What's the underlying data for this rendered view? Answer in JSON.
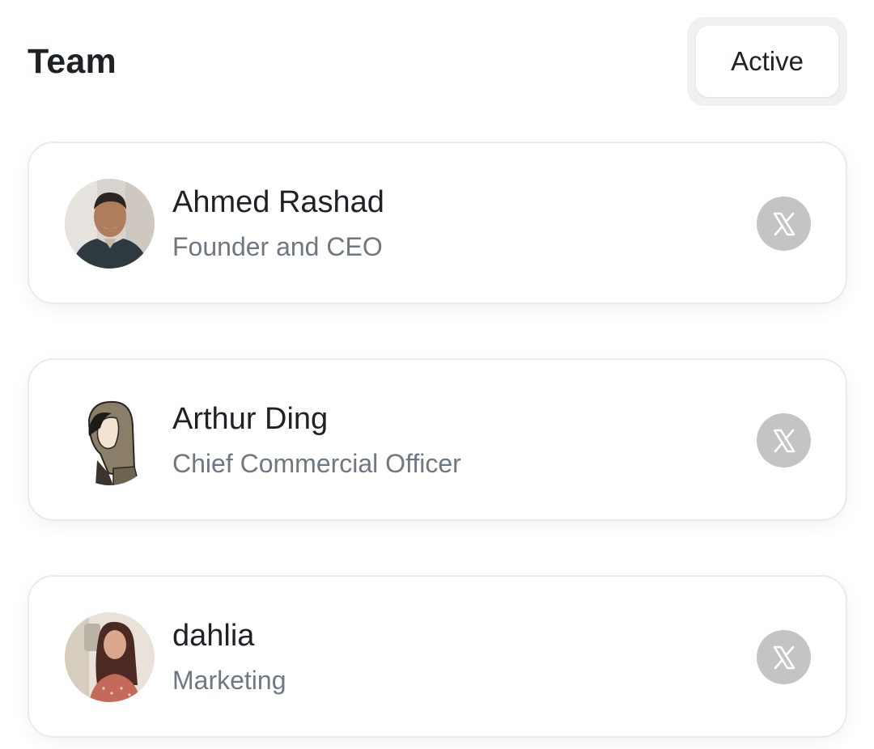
{
  "header": {
    "title": "Team",
    "filter_label": "Active"
  },
  "members": [
    {
      "name": "Ahmed Rashad",
      "role": "Founder and CEO",
      "social": "x-icon"
    },
    {
      "name": "Arthur Ding",
      "role": "Chief Commercial Officer",
      "social": "x-icon"
    },
    {
      "name": "dahlia",
      "role": "Marketing",
      "social": "x-icon"
    }
  ],
  "colors": {
    "card_border": "#e8eaed",
    "role_text": "#6f7782",
    "social_button": "#c4c4c4",
    "filter_bg": "#eef0f2"
  }
}
